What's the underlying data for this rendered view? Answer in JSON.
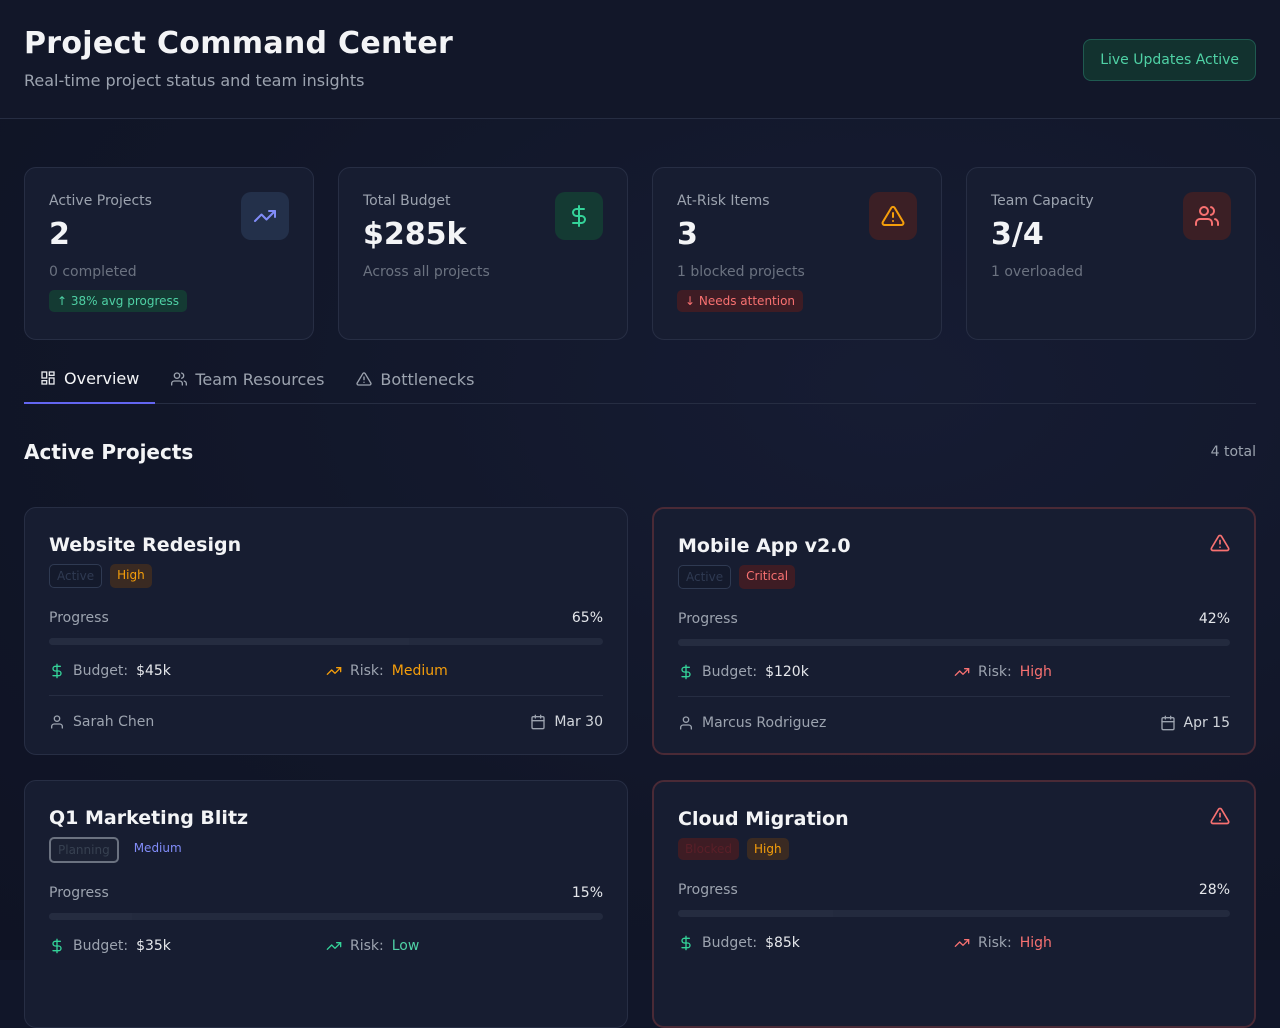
{
  "header": {
    "title": "Project Command Center",
    "subtitle": "Real-time project status and team insights",
    "live_label": "Live Updates Active"
  },
  "stats": [
    {
      "label": "Active Projects",
      "value": "2",
      "sub": "0 completed",
      "badge": "↑ 38% avg progress",
      "icon": "trending-up-icon",
      "color": "#818cf8"
    },
    {
      "label": "Total Budget",
      "value": "$285k",
      "sub": "Across all projects",
      "icon": "dollar-icon",
      "color": "#34d399"
    },
    {
      "label": "At-Risk Items",
      "value": "3",
      "sub": "1 blocked projects",
      "badge": "↓ Needs attention",
      "icon": "alert-triangle-icon",
      "color": "#f59e0b"
    },
    {
      "label": "Team Capacity",
      "value": "3/4",
      "sub": "1 overloaded",
      "icon": "users-icon",
      "color": "#f87171"
    }
  ],
  "tabs": [
    {
      "label": "Overview",
      "icon": "grid-icon",
      "active": true
    },
    {
      "label": "Team Resources",
      "icon": "users-icon"
    },
    {
      "label": "Bottlenecks",
      "icon": "alert-triangle-icon"
    }
  ],
  "section": {
    "title": "Active Projects",
    "count": "4 total"
  },
  "labels": {
    "progress": "Progress",
    "budget": "Budget:",
    "risk": "Risk:"
  },
  "projects": [
    {
      "name": "Website Redesign",
      "status": "Active",
      "priority": "High",
      "progress_label": "65%",
      "progress": 65,
      "budget": "$45k",
      "risk": "Medium",
      "owner": "Sarah Chen",
      "due": "Mar 30"
    },
    {
      "name": "Mobile App v2.0",
      "status": "Active",
      "priority": "Critical",
      "progress_label": "42%",
      "progress": 42,
      "budget": "$120k",
      "risk": "High",
      "owner": "Marcus Rodriguez",
      "due": "Apr 15"
    },
    {
      "name": "Q1 Marketing Blitz",
      "status": "Planning",
      "priority": "Medium",
      "progress_label": "15%",
      "progress": 15,
      "budget": "$35k",
      "risk": "Low"
    },
    {
      "name": "Cloud Migration",
      "status": "Blocked",
      "priority": "High",
      "progress_label": "28%",
      "progress": 28,
      "budget": "$85k",
      "risk": "High"
    }
  ]
}
